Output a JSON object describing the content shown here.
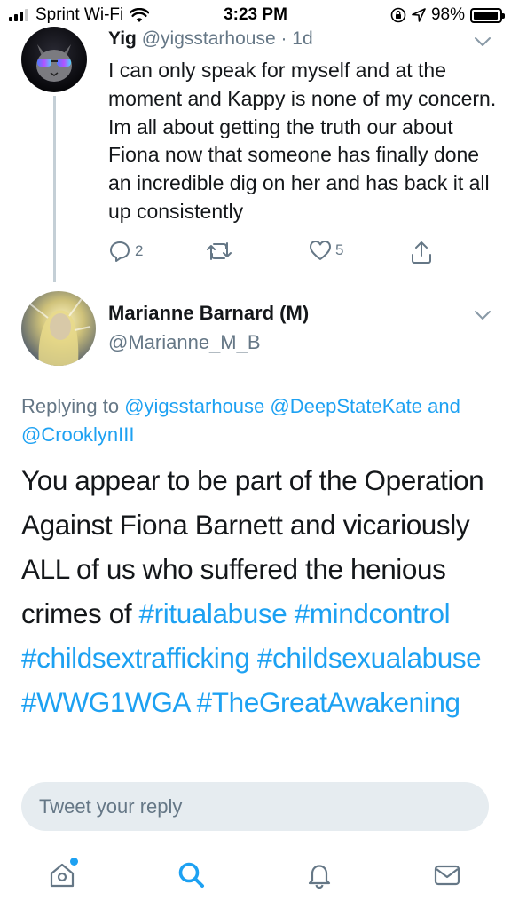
{
  "status_bar": {
    "carrier": "Sprint Wi-Fi",
    "time": "3:23 PM",
    "battery": "98%",
    "battery_level": 0.98
  },
  "tweets": [
    {
      "name": "Yig",
      "handle": "@yigsstarhouse",
      "age": "· 1d",
      "text": "I can only speak for myself and at the moment and Kappy is none of my concern. Im all about getting the truth our about Fiona now that someone has finally done an incredible dig on her and has back it all up consistently",
      "reply_count": "2",
      "like_count": "5",
      "avatar": "cat-with-sunglasses-avatar"
    },
    {
      "name": "Marianne Barnard (M)",
      "handle": "@Marianne_M_B",
      "avatar": "blonde-woman-avatar",
      "replying_prefix": "Replying to",
      "replying_users": [
        "@yigsstarhouse",
        "@DeepStateKate"
      ],
      "replying_and": "and",
      "replying_last": "@CrooklynIII",
      "text_plain": "You appear to be part of the Operation Against Fiona Barnett and vicariously ALL of us who suffered the henious crimes of",
      "hashtags": [
        "#ritualabuse",
        "#mindcontrol",
        "#childsextrafficking",
        "#childsexualabuse",
        "#WWG1WGA",
        "#TheGreatAwakening"
      ]
    }
  ],
  "reply_box": {
    "placeholder": "Tweet your reply"
  },
  "tabbar": {
    "items": [
      "home-icon",
      "search-icon",
      "notifications-icon",
      "messages-icon"
    ],
    "home_has_new_dot": true
  },
  "colors": {
    "accent": "#1da1f2",
    "secondary_text": "#657786",
    "primary_text": "#14171a",
    "input_bg": "#e6ecf0"
  }
}
